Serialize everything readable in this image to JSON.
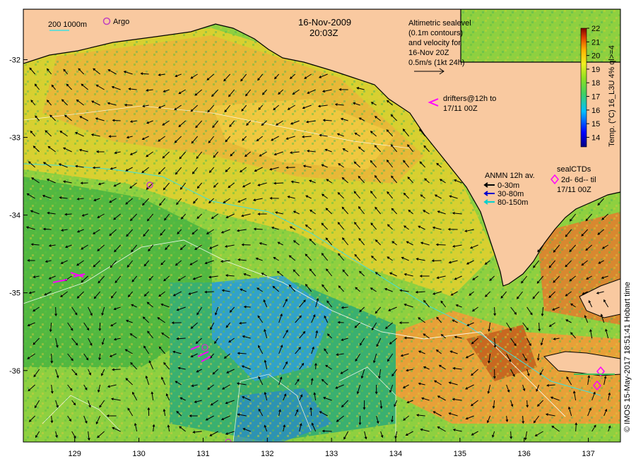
{
  "map": {
    "date": "16-Nov-2009",
    "time": "20:03Z",
    "x_ticks": [
      "129",
      "130",
      "131",
      "132",
      "133",
      "134",
      "135",
      "136",
      "137"
    ],
    "y_ticks": [
      "-32",
      "-33",
      "-34",
      "-35",
      "-36"
    ],
    "x_range": [
      128.2,
      137.5
    ],
    "y_range": [
      -31.35,
      -36.92
    ],
    "colors": {
      "land": "#f9c9a0",
      "ocean_mid": "#9ad43a",
      "warm": "#e89a3a",
      "cool": "#2aa0e0"
    }
  },
  "legend": {
    "isobath_label": "200  1000m",
    "argo_label": "Argo",
    "altimetry_lines": [
      "Altimetric sealevel",
      "(0.1m contours)",
      "and velocity for",
      "16-Nov 20Z",
      "0.5m/s (1kt 24h)"
    ],
    "drifters_lines": [
      "drifters@12h to",
      "17/11 00Z"
    ],
    "anmn_title": "ANMN 12h av.",
    "anmn_items": [
      {
        "label": "0-30m",
        "color": "#000000"
      },
      {
        "label": "30-80m",
        "color": "#0000cc"
      },
      {
        "label": "80-150m",
        "color": "#00d0d0"
      }
    ],
    "seal_lines": [
      "sealCTDs",
      "2d- 6d-- til",
      "17/11 00Z"
    ]
  },
  "colorbar": {
    "ticks": [
      "22",
      "21",
      "20",
      "19",
      "18",
      "17",
      "16",
      "15",
      "14"
    ],
    "min": 13.3,
    "max": 22,
    "label": "Temp. (°C) 16_L3U 4% ql>=4"
  },
  "credit": "© IMOS 15-May-2017 18:51:41 Hobart time"
}
